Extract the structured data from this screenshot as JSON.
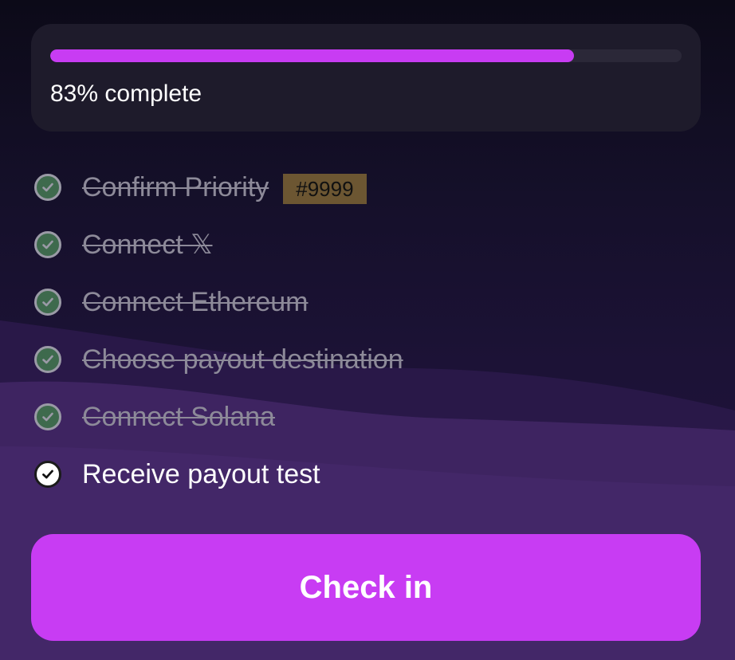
{
  "progress": {
    "percent": 83,
    "label": "83% complete"
  },
  "steps": [
    {
      "label": "Confirm Priority",
      "done": true,
      "badge": "#9999"
    },
    {
      "label": "Connect 𝕏",
      "done": true
    },
    {
      "label": "Connect Ethereum",
      "done": true
    },
    {
      "label": "Choose payout destination",
      "done": true
    },
    {
      "label": "Connect Solana",
      "done": true
    },
    {
      "label": "Receive payout test",
      "done": false
    }
  ],
  "button": {
    "label": "Check in"
  },
  "colors": {
    "accent": "#c83cf3",
    "completed_check": "#3e6a4d",
    "badge_bg": "#6c5632",
    "card_bg": "#1e1b2b"
  },
  "icons": {
    "step_done": "check-circle-icon",
    "step_active": "check-circle-icon"
  }
}
